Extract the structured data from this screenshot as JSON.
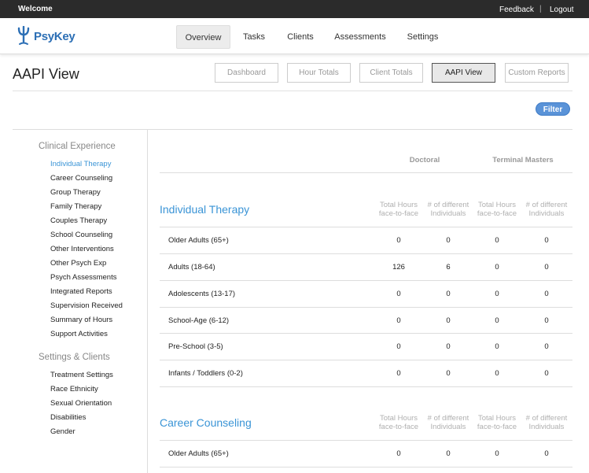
{
  "topbar": {
    "welcome": "Welcome",
    "feedback": "Feedback",
    "separator": "|",
    "logout": "Logout"
  },
  "logo": {
    "text": "PsyKey"
  },
  "nav": [
    "Overview",
    "Tasks",
    "Clients",
    "Assessments",
    "Settings"
  ],
  "page": {
    "title": "AAPI View"
  },
  "view_buttons": [
    "Dashboard",
    "Hour Totals",
    "Client Totals",
    "AAPI View",
    "Custom Reports"
  ],
  "filter_label": "Filter",
  "sidebar": {
    "clinical_heading": "Clinical Experience",
    "clinical_items": [
      "Individual Therapy",
      "Career Counseling",
      "Group Therapy",
      "Family Therapy",
      "Couples Therapy",
      "School Counseling",
      "Other Interventions",
      "Other Psych Exp",
      "Psych Assessments",
      "Integrated Reports",
      "Supervision Received",
      "Summary of Hours",
      "Support Activities"
    ],
    "settings_heading": "Settings & Clients",
    "settings_items": [
      "Treatment Settings",
      "Race Ethnicity",
      "Sexual Orientation",
      "Disabilities",
      "Gender"
    ]
  },
  "groups": {
    "doctoral": "Doctoral",
    "terminal_masters": "Terminal Masters"
  },
  "col_headers": {
    "total_hours_1": "Total Hours",
    "total_hours_2": "face-to-face",
    "individuals_1": "# of different",
    "individuals_2": "Individuals"
  },
  "sections": [
    {
      "title": "Individual Therapy",
      "rows": [
        {
          "label": "Older Adults (65+)",
          "values": [
            "0",
            "0",
            "0",
            "0"
          ]
        },
        {
          "label": "Adults (18-64)",
          "values": [
            "126",
            "6",
            "0",
            "0"
          ]
        },
        {
          "label": "Adolescents (13-17)",
          "values": [
            "0",
            "0",
            "0",
            "0"
          ]
        },
        {
          "label": "School-Age (6-12)",
          "values": [
            "0",
            "0",
            "0",
            "0"
          ]
        },
        {
          "label": "Pre-School (3-5)",
          "values": [
            "0",
            "0",
            "0",
            "0"
          ]
        },
        {
          "label": "Infants / Toddlers (0-2)",
          "values": [
            "0",
            "0",
            "0",
            "0"
          ]
        }
      ]
    },
    {
      "title": "Career Counseling",
      "rows": [
        {
          "label": "Older Adults (65+)",
          "values": [
            "0",
            "0",
            "0",
            "0"
          ]
        }
      ]
    }
  ],
  "colors": {
    "accent": "#3a94d6",
    "topbar": "#2b2b2b",
    "filter": "#5a93d8"
  }
}
